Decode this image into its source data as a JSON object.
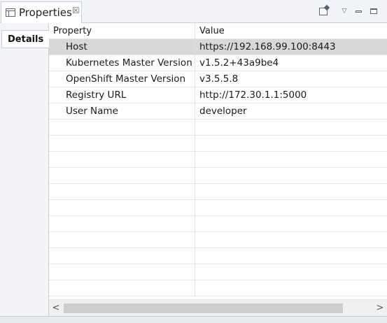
{
  "view": {
    "title": "Properties",
    "close_glyph": "☒",
    "menu_glyph": "▽"
  },
  "side_tabs": [
    {
      "label": "Details"
    }
  ],
  "table": {
    "headers": [
      "Property",
      "Value"
    ],
    "rows": [
      {
        "property": "Host",
        "value": "https://192.168.99.100:8443",
        "selected": true
      },
      {
        "property": "Kubernetes Master Version",
        "value": "v1.5.2+43a9be4",
        "selected": false
      },
      {
        "property": "OpenShift Master Version",
        "value": "v3.5.5.8",
        "selected": false
      },
      {
        "property": "Registry URL",
        "value": "http://172.30.1.1:5000",
        "selected": false
      },
      {
        "property": "User Name",
        "value": "developer",
        "selected": false
      }
    ],
    "empty_row_count": 11
  },
  "scrollbar": {
    "left_arrow": "<",
    "right_arrow": ">"
  },
  "icons": {
    "view": "properties-view-icon",
    "close": "close-icon",
    "pin": "pin-view-icon",
    "menu": "view-menu-icon",
    "minimize": "minimize-icon",
    "maximize": "maximize-icon"
  }
}
